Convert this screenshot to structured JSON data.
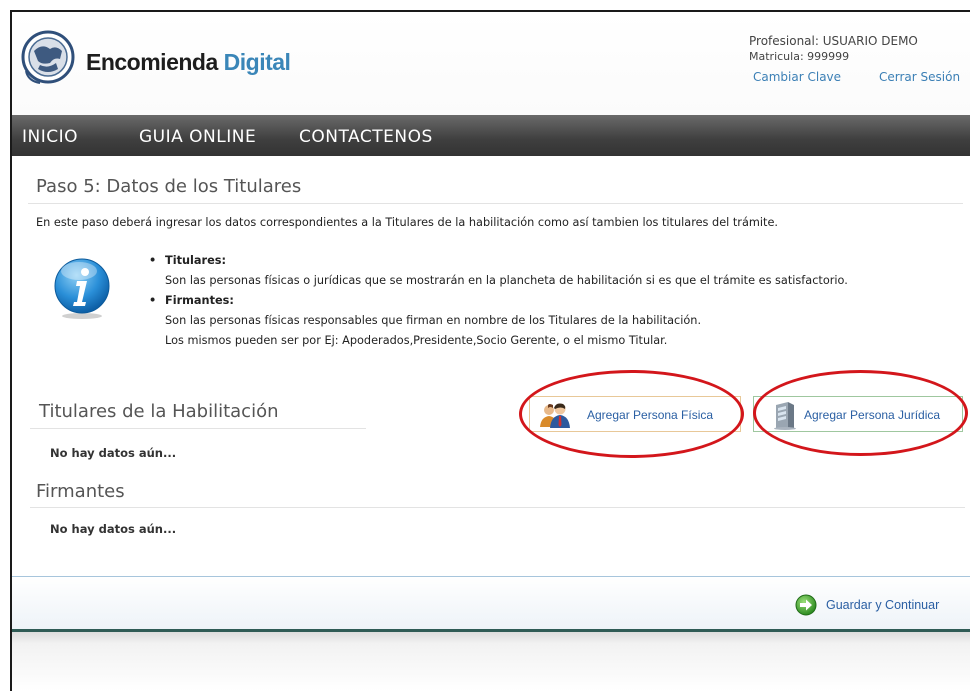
{
  "header": {
    "logo_text_main": "Encomienda",
    "logo_text_accent": "Digital",
    "profesional": "Profesional: USUARIO DEMO",
    "matricula": "Matricula: 999999",
    "change_password": "Cambiar Clave",
    "logout": "Cerrar Sesión"
  },
  "nav": {
    "items": [
      "INICIO",
      "GUIA ONLINE",
      "CONTACTENOS"
    ]
  },
  "step": {
    "title": "Paso 5: Datos de los Titulares",
    "intro": "En este paso deberá ingresar los datos correspondientes a la Titulares de la habilitación como así tambien los titulares del trámite.",
    "bullets": [
      {
        "title": "Titulares:",
        "lines": [
          "Son las personas físicas o jurídicas que se mostrarán en la plancheta de habilitación si es que el trámite es satisfactorio."
        ]
      },
      {
        "title": "Firmantes:",
        "lines": [
          "Son las personas físicas responsables que firman en nombre de los Titulares de la habilitación.",
          "Los mismos pueden ser por Ej: Apoderados,Presidente,Socio Gerente, o el mismo Titular."
        ]
      }
    ]
  },
  "titulares": {
    "title": "Titulares de la Habilitación",
    "empty": "No hay datos aún...",
    "add_fisica": "Agregar Persona Física",
    "add_juridica": "Agregar Persona Jurídica"
  },
  "firmantes": {
    "title": "Firmantes",
    "empty": "No hay datos aún..."
  },
  "footer": {
    "save_continue": "Guardar y Continuar"
  },
  "colors": {
    "nav_bg": "#3f3f3f",
    "link": "#3b7fb5",
    "annotation_circle": "#d3161b",
    "footer_band": "#2f5b55"
  }
}
